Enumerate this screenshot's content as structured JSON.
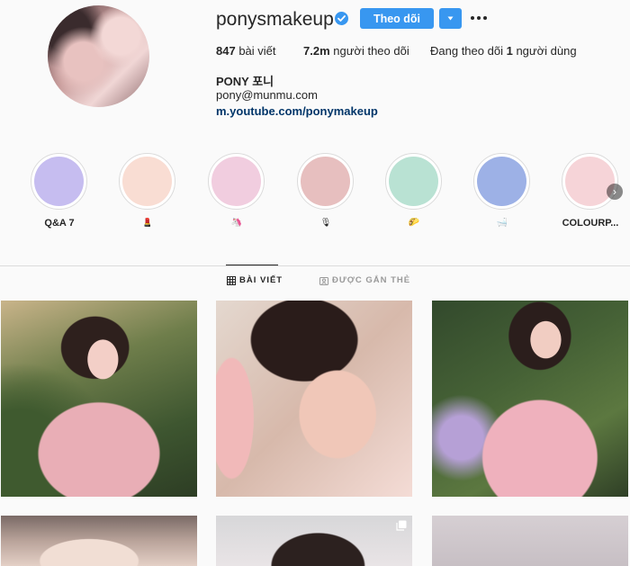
{
  "profile": {
    "username": "ponysmakeup",
    "follow_label": "Theo dõi",
    "stats": {
      "posts_count": "847",
      "posts_label": "bài viết",
      "followers_count": "7.2m",
      "followers_label": "người theo dõi",
      "following_prefix": "Đang theo dõi",
      "following_count": "1",
      "following_suffix": "người dùng"
    },
    "full_name": "PONY 포니",
    "email": "pony@munmu.com",
    "link": "m.youtube.com/ponymakeup"
  },
  "highlights": [
    {
      "label": "Q&A 7",
      "color": "#c6bdf0"
    },
    {
      "label": "💄",
      "color": "#f9ddd3"
    },
    {
      "label": "🦄",
      "color": "#f1cddf"
    },
    {
      "label": "🎙",
      "color": "#e7bfbf"
    },
    {
      "label": "🌮",
      "color": "#b9e2d3"
    },
    {
      "label": "🛁",
      "color": "#9db1e6"
    },
    {
      "label": "COLOURP...",
      "color": "#f6d4d8"
    }
  ],
  "tabs": {
    "posts": "BÀI VIẾT",
    "tagged": "ĐƯỢC GẮN THẺ"
  },
  "colors": {
    "accent": "#3897f0",
    "link": "#003569"
  }
}
